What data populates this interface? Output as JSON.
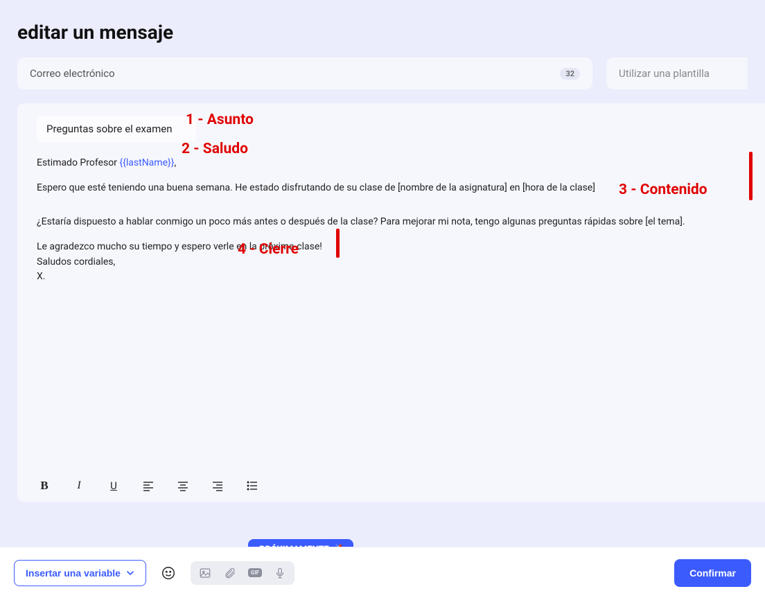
{
  "page_title": "editar un mensaje",
  "channel": {
    "label": "Correo electrónico",
    "count": "32"
  },
  "template_placeholder": "Utilizar una plantilla",
  "subject": "Preguntas sobre el examen",
  "body": {
    "greeting_pre": "Estimado Profesor ",
    "greeting_var": "{{lastName}}",
    "greeting_post": ",",
    "line1": "Espero que esté teniendo una buena semana. He estado disfrutando de su clase de [nombre de la asignatura] en [hora de la clase]",
    "line2": "¿Estaría dispuesto a hablar conmigo un poco más antes o después de la clase? Para mejorar mi nota, tengo algunas preguntas rápidas sobre [el tema].",
    "close1": "Le agradezco mucho su tiempo y espero verle en la próxima clase!",
    "close2": "Saludos cordiales,",
    "close3": "X."
  },
  "annotations": {
    "a1": "1 - Asunto",
    "a2": "2 - Saludo",
    "a3": "3 - Contenido",
    "a4": "4 - Cierre"
  },
  "bottom": {
    "insert_variable": "Insertar una variable",
    "coming_soon": "PRÓXIMAMENTE 🚀",
    "confirm": "Confirmar",
    "gif_label": "GIF"
  }
}
